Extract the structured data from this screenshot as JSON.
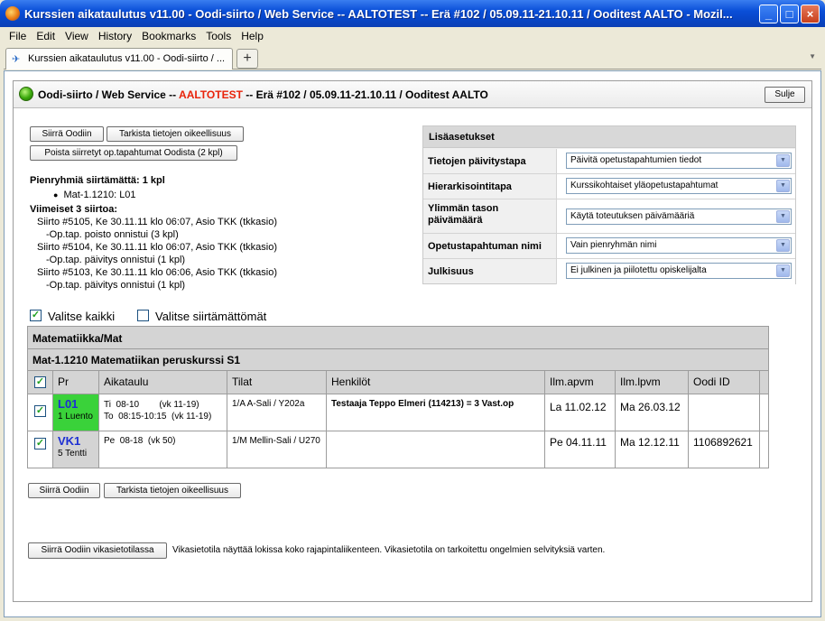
{
  "window": {
    "title": "Kurssien aikataulutus v11.00 - Oodi-siirto / Web Service -- AALTOTEST -- Erä #102 / 05.09.11-21.10.11 / Ooditest AALTO - Mozil...",
    "buttons": {
      "minimize": "_",
      "maximize": "□",
      "close": "×"
    }
  },
  "menu": [
    "File",
    "Edit",
    "View",
    "History",
    "Bookmarks",
    "Tools",
    "Help"
  ],
  "tab": {
    "label": "Kurssien aikataulutus v11.00 - Oodi-siirto / ...",
    "new_tab": "+"
  },
  "header": {
    "title_prefix": "Oodi-siirto / Web Service -- ",
    "title_env": "AALTOTEST",
    "title_suffix": " -- Erä #102 / 05.09.11-21.10.11 / Ooditest AALTO",
    "close_label": "Sulje"
  },
  "actions": {
    "transfer": "Siirrä Oodiin",
    "verify": "Tarkista tietojen oikeellisuus",
    "remove": "Poista siirretyt op.tapahtumat Oodista (2 kpl)"
  },
  "status": {
    "untransferred": "Pienryhmiä siirtämättä: 1 kpl",
    "untransferred_item": "Mat-1.1210: L01",
    "recent_title": "Viimeiset 3 siirtoa:",
    "recent": [
      {
        "line": "Siirto #5105, Ke 30.11.11 klo 06:07, Asio TKK (tkkasio)",
        "result": "-Op.tap. poisto onnistui (3 kpl)"
      },
      {
        "line": "Siirto #5104, Ke 30.11.11 klo 06:07, Asio TKK (tkkasio)",
        "result": "-Op.tap. päivitys onnistui (1 kpl)"
      },
      {
        "line": "Siirto #5103, Ke 30.11.11 klo 06:06, Asio TKK (tkkasio)",
        "result": "-Op.tap. päivitys onnistui (1 kpl)"
      }
    ]
  },
  "settings": {
    "title": "Lisäasetukset",
    "rows": [
      {
        "label": "Tietojen päivitystapa",
        "value": "Päivitä opetustapahtumien tiedot"
      },
      {
        "label": "Hierarkisointitapa",
        "value": "Kurssikohtaiset yläopetustapahtumat"
      },
      {
        "label": "Ylimmän tason\npäivämäärä",
        "value": "Käytä toteutuksen päivämääriä"
      },
      {
        "label": "Opetustapahtuman nimi",
        "value": "Vain pienryhmän nimi"
      },
      {
        "label": "Julkisuus",
        "value": "Ei julkinen ja piilotettu opiskelijalta"
      }
    ]
  },
  "select_all": {
    "label": "Valitse kaikki",
    "checked": true
  },
  "select_untransferred": {
    "label": "Valitse siirtämättömät",
    "checked": false
  },
  "course": {
    "department": "Matematiikka/Mat",
    "name": "Mat-1.1210 Matematiikan peruskurssi S1",
    "columns": [
      "Pr",
      "Aikataulu",
      "Tilat",
      "Henkilöt",
      "Ilm.apvm",
      "Ilm.lpvm",
      "Oodi ID"
    ],
    "rows": [
      {
        "checked": true,
        "code": "L01",
        "type": "1 Luento",
        "schedule": [
          "Ti  08-10        (vk 11-19)",
          "To  08:15-10:15  (vk 11-19)"
        ],
        "rooms": "1/A A-Sali / Y202a",
        "persons": "Testaaja Teppo Elmeri (114213) = 3 Vast.op",
        "start": "La 11.02.12",
        "end": "Ma 26.03.12",
        "oodi_id": "",
        "highlight": "#3ad23a"
      },
      {
        "checked": true,
        "code": "VK1",
        "type": "5 Tentti",
        "schedule": [
          "Pe  08-18  (vk 50)"
        ],
        "rooms": "1/M Mellin-Sali / U270",
        "persons": "",
        "start": "Pe 04.11.11",
        "end": "Ma 12.12.11",
        "oodi_id": "1106892621",
        "highlight": "#d4d4d4"
      }
    ]
  },
  "debug": {
    "button": "Siirrä Oodiin vikasietotilassa",
    "note": "Vikasietotila näyttää lokissa koko rajapintaliikenteen. Vikasietotila on tarkoitettu ongelmien selvityksiä varten."
  }
}
